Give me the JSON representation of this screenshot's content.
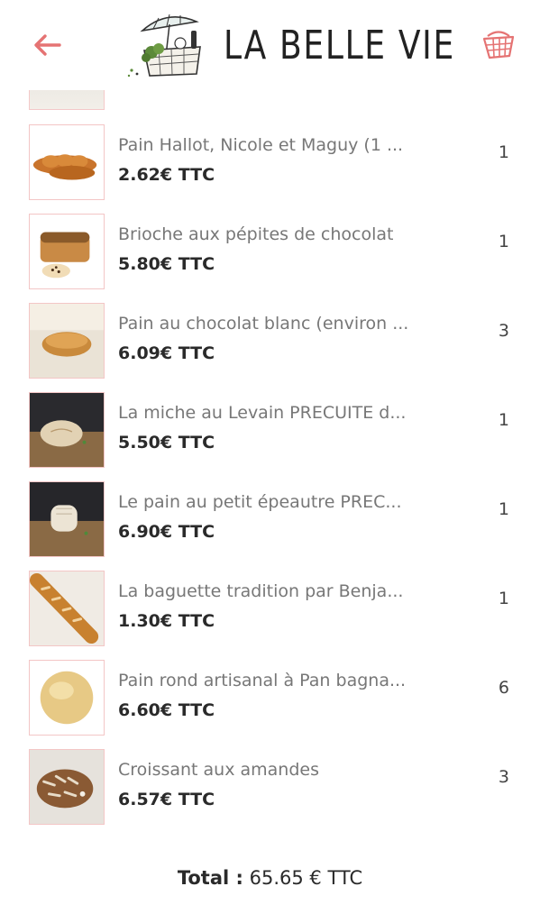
{
  "header": {
    "logo_text": "LA BELLE VIE",
    "back_icon": "arrow-left-icon",
    "basket_icon": "shopping-basket-icon",
    "accent_color": "#e57373"
  },
  "cart": {
    "items": [
      {
        "name": "Pain Hallot, Nicole et Maguy (1 ...",
        "price": "2.62€ TTC",
        "qty": "1"
      },
      {
        "name": "Brioche aux pépites de chocolat",
        "price": "5.80€ TTC",
        "qty": "1"
      },
      {
        "name": "Pain au chocolat blanc (environ ...",
        "price": "6.09€ TTC",
        "qty": "3"
      },
      {
        "name": "La miche au Levain PRECUITE d...",
        "price": "5.50€ TTC",
        "qty": "1"
      },
      {
        "name": "Le pain au petit épeautre PREC...",
        "price": "6.90€ TTC",
        "qty": "1"
      },
      {
        "name": "La baguette tradition par Benja...",
        "price": "1.30€ TTC",
        "qty": "1"
      },
      {
        "name": "Pain rond artisanal à Pan bagna...",
        "price": "6.60€ TTC",
        "qty": "6"
      },
      {
        "name": "Croissant aux amandes",
        "price": "6.57€ TTC",
        "qty": "3"
      }
    ]
  },
  "footer": {
    "total_label": "Total :",
    "total_value": "65.65 € TTC"
  }
}
